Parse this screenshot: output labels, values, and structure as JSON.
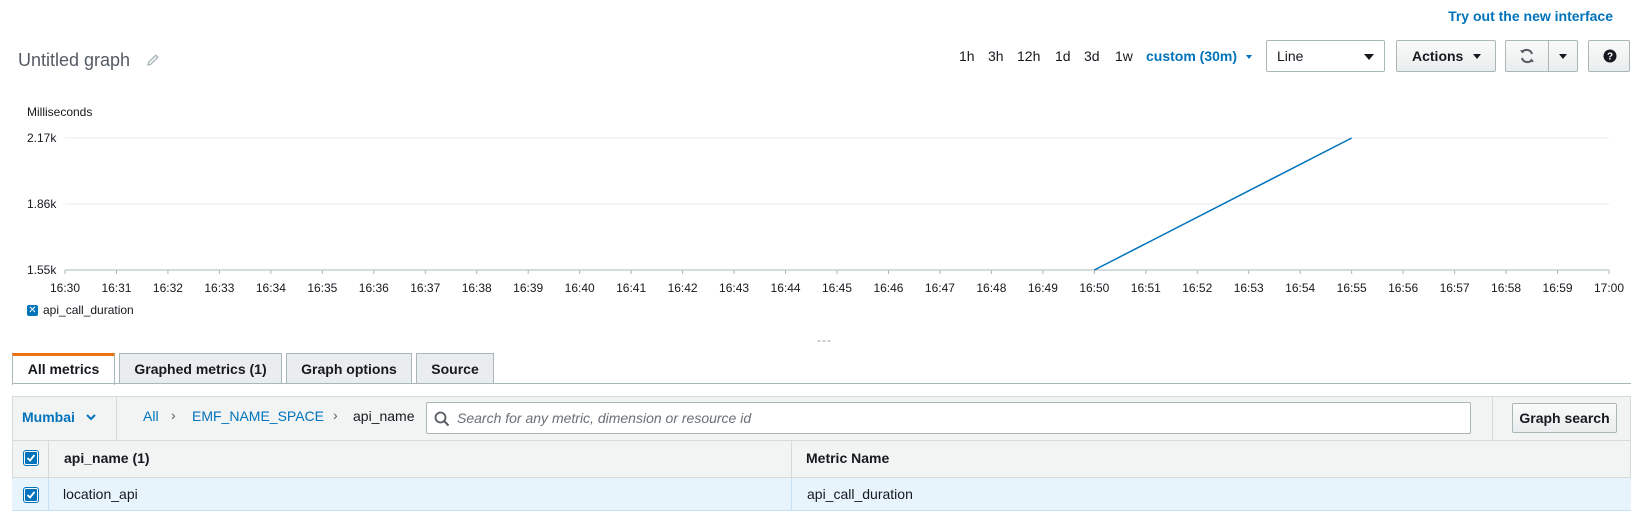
{
  "header": {
    "try_new_link": "Try out the new interface",
    "graph_title": "Untitled graph"
  },
  "toolbar": {
    "ranges": [
      "1h",
      "3h",
      "12h",
      "1d",
      "3d",
      "1w"
    ],
    "custom_range": "custom (30m)",
    "graph_type": "Line",
    "actions_label": "Actions"
  },
  "chart_data": {
    "type": "line",
    "title": "",
    "ylabel": "Milliseconds",
    "xlabel": "",
    "x": [
      "16:30",
      "16:31",
      "16:32",
      "16:33",
      "16:34",
      "16:35",
      "16:36",
      "16:37",
      "16:38",
      "16:39",
      "16:40",
      "16:41",
      "16:42",
      "16:43",
      "16:44",
      "16:45",
      "16:46",
      "16:47",
      "16:48",
      "16:49",
      "16:50",
      "16:51",
      "16:52",
      "16:53",
      "16:54",
      "16:55",
      "16:56",
      "16:57",
      "16:58",
      "16:59",
      "17:00"
    ],
    "y_ticks": [
      "1.55k",
      "1.86k",
      "2.17k"
    ],
    "ylim": [
      1550,
      2170
    ],
    "series": [
      {
        "name": "api_call_duration",
        "color": "#0073bb",
        "points": [
          {
            "x": "16:50",
            "y": 1550
          },
          {
            "x": "16:55",
            "y": 2170
          }
        ]
      }
    ],
    "grid": true,
    "legend": "bottom-left"
  },
  "legend": {
    "label": "api_call_duration"
  },
  "drag_handle": "---",
  "tabs": [
    {
      "label": "All metrics",
      "active": true
    },
    {
      "label": "Graphed metrics (1)",
      "active": false
    },
    {
      "label": "Graph options",
      "active": false
    },
    {
      "label": "Source",
      "active": false
    }
  ],
  "filter": {
    "region": "Mumbai",
    "breadcrumb": [
      "All",
      "EMF_NAME_SPACE",
      "api_name"
    ],
    "search_placeholder": "Search for any metric, dimension or resource id",
    "graph_search_label": "Graph search"
  },
  "table": {
    "columns": [
      "api_name  (1)",
      "Metric Name"
    ],
    "rows": [
      {
        "checked": true,
        "api_name": "location_api",
        "metric_name": "api_call_duration"
      }
    ]
  }
}
